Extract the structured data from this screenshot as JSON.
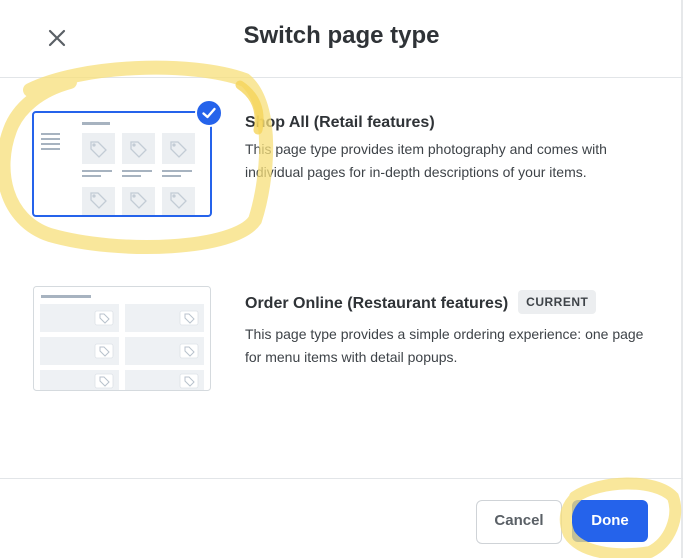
{
  "dialog": {
    "title": "Switch page type"
  },
  "options": [
    {
      "title": "Shop All (Retail features)",
      "description": "This page type provides item photography and comes with individual pages for in-depth descriptions of your items.",
      "selected": true
    },
    {
      "title": "Order Online (Restaurant features)",
      "badge": "CURRENT",
      "description": "This page type provides a simple ordering experience: one page for menu items with detail popups.",
      "selected": false
    }
  ],
  "footer": {
    "cancel_label": "Cancel",
    "done_label": "Done"
  },
  "colors": {
    "accent": "#2563eb",
    "highlight": "#f7df7a"
  },
  "icons": [
    "close-icon",
    "check-icon",
    "tag-icon"
  ]
}
